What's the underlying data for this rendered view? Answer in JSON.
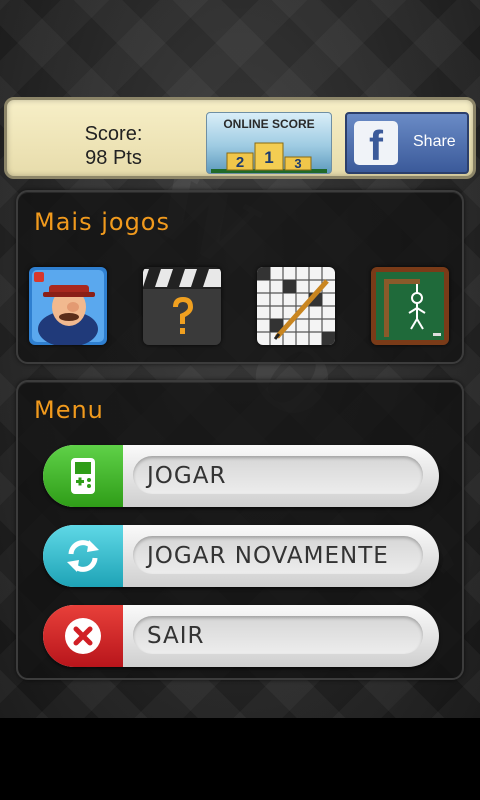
{
  "score": {
    "label": "Score:",
    "value": "98 Pts"
  },
  "online_score": {
    "label": "ONLINE SCORE",
    "podium": [
      "2",
      "1",
      "3"
    ]
  },
  "facebook": {
    "logo": "f",
    "label": "Share"
  },
  "more_games": {
    "title": "Mais jogos",
    "items": [
      {
        "icon": "detective-game-icon"
      },
      {
        "icon": "movie-quiz-icon"
      },
      {
        "icon": "crossword-game-icon"
      },
      {
        "icon": "hangman-game-icon"
      }
    ]
  },
  "menu": {
    "title": "Menu",
    "buttons": [
      {
        "label": "JOGAR",
        "icon": "gamepad-icon",
        "color": "#35b51f"
      },
      {
        "label": "JOGAR NOVAMENTE",
        "icon": "refresh-icon",
        "color": "#2ab6c8"
      },
      {
        "label": "SAIR",
        "icon": "close-icon",
        "color": "#d11f25"
      }
    ]
  },
  "colors": {
    "accent": "#f19a1d",
    "facebook": "#3b5a9a"
  }
}
